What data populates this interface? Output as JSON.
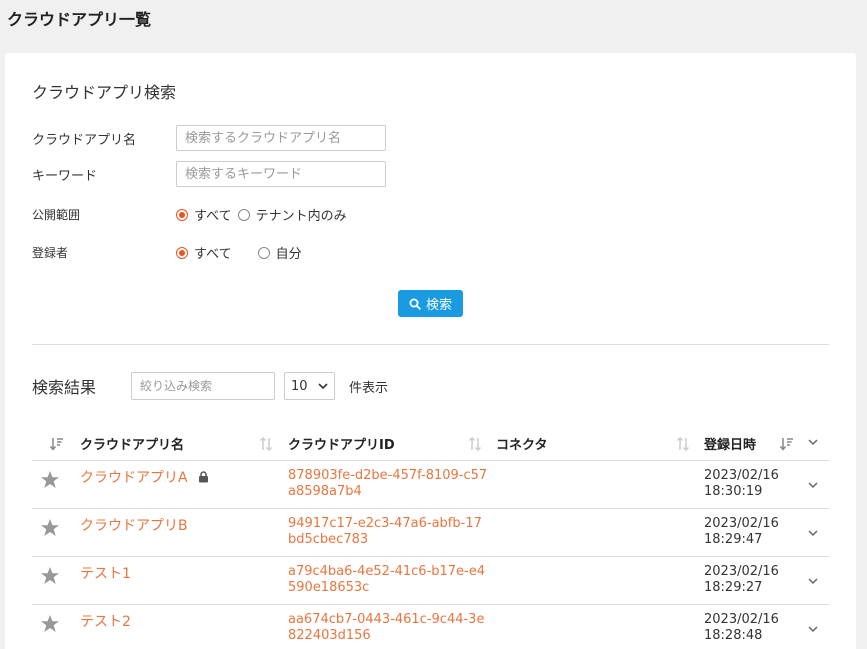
{
  "page": {
    "title": "クラウドアプリ一覧"
  },
  "search": {
    "title": "クラウドアプリ検索",
    "app_name_label": "クラウドアプリ名",
    "app_name_placeholder": "検索するクラウドアプリ名",
    "keyword_label": "キーワード",
    "keyword_placeholder": "検索するキーワード",
    "scope_label": "公開範囲",
    "scope_options": [
      "すべて",
      "テナント内のみ"
    ],
    "scope_selected": "すべて",
    "registrant_label": "登録者",
    "registrant_options": [
      "すべて",
      "自分"
    ],
    "registrant_selected": "すべて",
    "search_button": "検索"
  },
  "results": {
    "title": "検索結果",
    "filter_placeholder": "絞り込み検索",
    "page_size": "10",
    "page_size_suffix": "件表示",
    "columns": [
      "クラウドアプリ名",
      "クラウドアプリID",
      "コネクタ",
      "登録日時"
    ],
    "rows": [
      {
        "name": "クラウドアプリA",
        "locked": true,
        "id": "878903fe-d2be-457f-8109-c57a8598a7b4",
        "connector": "",
        "date": "2023/02/16",
        "time": "18:30:19"
      },
      {
        "name": "クラウドアプリB",
        "locked": false,
        "id": "94917c17-e2c3-47a6-abfb-17bd5cbec783",
        "connector": "",
        "date": "2023/02/16",
        "time": "18:29:47"
      },
      {
        "name": "テスト1",
        "locked": false,
        "id": "a79c4ba6-4e52-41c6-b17e-e4590e18653c",
        "connector": "",
        "date": "2023/02/16",
        "time": "18:29:27"
      },
      {
        "name": "テスト2",
        "locked": false,
        "id": "aa674cb7-0443-461c-9c44-3e822403d156",
        "connector": "",
        "date": "2023/02/16",
        "time": "18:28:48"
      }
    ]
  },
  "colors": {
    "accent": "#e8541c",
    "link": "#e8763f",
    "button": "#1a9ae0"
  }
}
